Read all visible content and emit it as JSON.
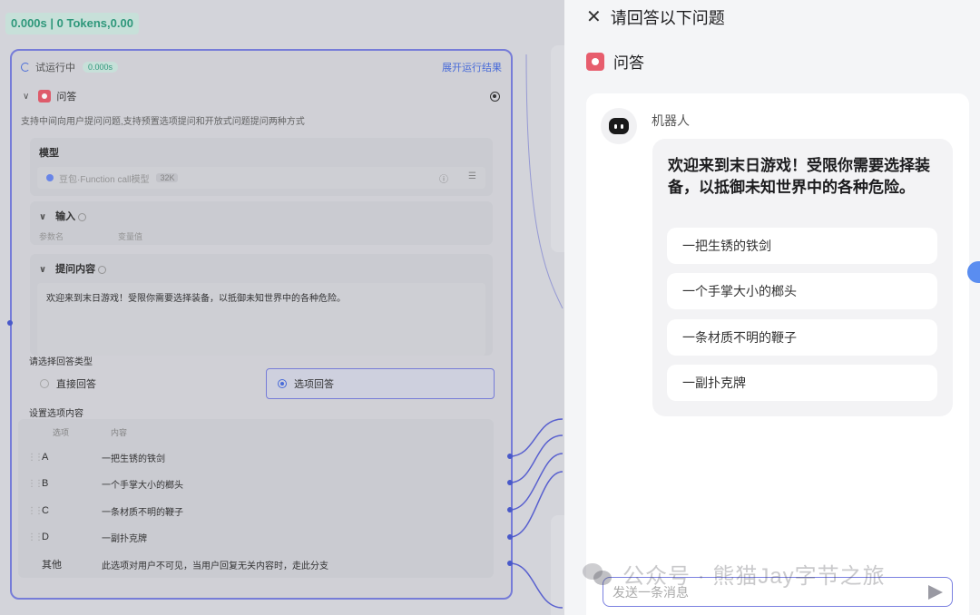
{
  "canvas": {
    "token_stats": "0.000s | 0 Tokens,0.00",
    "run": {
      "status": "试运行中",
      "elapsed": "0.000s",
      "expand_label": "展开运行结果"
    },
    "node": {
      "title": "问答",
      "description": "支持中间向用户提问问题,支持预置选项提问和开放式问题提问两种方式",
      "model_section": "模型",
      "model_name": "豆包·Function call模型",
      "model_ctx": "32K",
      "input_section": "输入",
      "param_col_name": "参数名",
      "param_col_value": "变量值",
      "prompt_section": "提问内容",
      "prompt_text": "欢迎来到末日游戏！受限你需要选择装备，以抵御未知世界中的各种危险。",
      "answer_type_label": "请选择回答类型",
      "answer_direct": "直接回答",
      "answer_option": "选项回答",
      "options_label": "设置选项内容",
      "col_option": "选项",
      "col_content": "内容",
      "options": [
        {
          "key": "A",
          "text": "一把生锈的铁剑"
        },
        {
          "key": "B",
          "text": "一个手掌大小的榔头"
        },
        {
          "key": "C",
          "text": "一条材质不明的鞭子"
        },
        {
          "key": "D",
          "text": "一副扑克牌"
        },
        {
          "key": "其他",
          "text": "此选项对用户不可见，当用户回复无关内容时，走此分支"
        }
      ]
    }
  },
  "drawer": {
    "title": "请回答以下问题",
    "node_label": "问答",
    "bot_name": "机器人",
    "message": "欢迎来到末日游戏！受限你需要选择装备，以抵御未知世界中的各种危险。",
    "choices": [
      "一把生锈的铁剑",
      "一个手掌大小的榔头",
      "一条材质不明的鞭子",
      "一副扑克牌"
    ],
    "input_placeholder": "发送一条消息",
    "watermark": "公众号 · 熊猫Jay字节之旅"
  },
  "colors": {
    "accent": "#7a80e0",
    "qa_badge": "#e75d6d",
    "token_green": "#2f9d7e"
  }
}
